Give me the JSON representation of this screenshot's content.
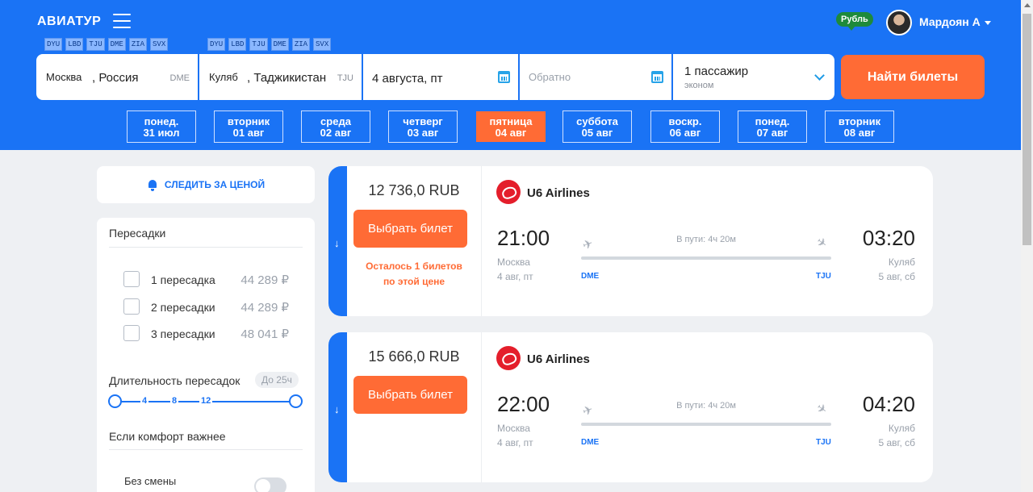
{
  "header": {
    "logo": "АВИАТУР",
    "chips_left": [
      "DYU",
      "LBD",
      "TJU",
      "DME",
      "ZIA",
      "SVX"
    ],
    "chips_right": [
      "DYU",
      "LBD",
      "TJU",
      "DME",
      "ZIA",
      "SVX"
    ],
    "currency": "Рубль",
    "user": "Мардоян А"
  },
  "search": {
    "from": {
      "city": "Москва",
      "country": ", Россия",
      "iata": "DME"
    },
    "to": {
      "city": "Куляб",
      "country": ", Таджикистан",
      "iata": "TJU"
    },
    "depart": "4 августа, пт",
    "return_placeholder": "Обратно",
    "passengers": "1 пассажир",
    "class": "эконом",
    "button": "Найти билеты"
  },
  "days": [
    {
      "dow": "понед.",
      "date": "31 июл"
    },
    {
      "dow": "вторник",
      "date": "01 авг"
    },
    {
      "dow": "среда",
      "date": "02 авг"
    },
    {
      "dow": "четверг",
      "date": "03 авг"
    },
    {
      "dow": "пятница",
      "date": "04 авг"
    },
    {
      "dow": "суббота",
      "date": "05 авг"
    },
    {
      "dow": "воскр.",
      "date": "06 авг"
    },
    {
      "dow": "понед.",
      "date": "07 авг"
    },
    {
      "dow": "вторник",
      "date": "08 авг"
    }
  ],
  "sidebar": {
    "notify": "СЛЕДИТЬ ЗА ЦЕНОЙ",
    "transfers_title": "Пересадки",
    "transfers": [
      {
        "label": "1 пересадка",
        "price": "44 289 ₽"
      },
      {
        "label": "2 пересадки",
        "price": "44 289 ₽"
      },
      {
        "label": "3 пересадки",
        "price": "48 041 ₽"
      }
    ],
    "duration_title": "Длительность пересадок",
    "duration_badge": "До 25ч",
    "duration_ticks": [
      "4",
      "8",
      "12"
    ],
    "comfort_title": "Если комфорт важнее",
    "no_change": "Без смены"
  },
  "results": [
    {
      "price": "12 736,0 RUB",
      "button": "Выбрать билет",
      "warning_1": "Осталось 1 билетов",
      "warning_2": "по этой цене",
      "airline": "U6 Airlines",
      "dep_time": "21:00",
      "arr_time": "03:20",
      "dep_city": "Москва",
      "arr_city": "Куляб",
      "dep_date": "4 авг, пт",
      "arr_date": "5 авг, сб",
      "transit": "В пути: 4ч 20м",
      "dep_iata": "DME",
      "arr_iata": "TJU"
    },
    {
      "price": "15 666,0 RUB",
      "button": "Выбрать билет",
      "warning_1": "",
      "warning_2": "",
      "airline": "U6 Airlines",
      "dep_time": "22:00",
      "arr_time": "04:20",
      "dep_city": "Москва",
      "arr_city": "Куляб",
      "dep_date": "4 авг, пт",
      "arr_date": "5 авг, сб",
      "transit": "В пути: 4ч 20м",
      "dep_iata": "DME",
      "arr_iata": "TJU"
    }
  ],
  "colors": {
    "brand": "#1a73f5",
    "accent": "#ff6b35",
    "currency_badge": "#1e8a3b"
  }
}
